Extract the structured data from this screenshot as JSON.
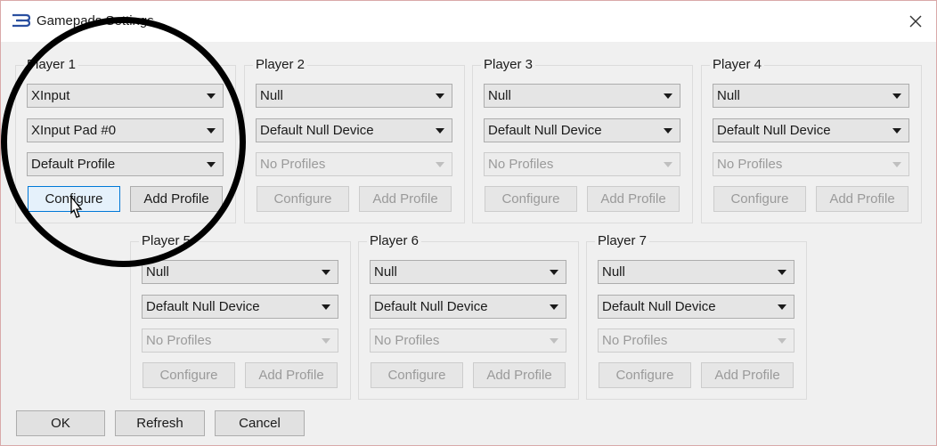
{
  "window": {
    "title": "Gamepads Settings"
  },
  "players": [
    {
      "label": "Player 1",
      "handler": "XInput",
      "device": "XInput Pad #0",
      "profile": "Default Profile",
      "configure": "Configure",
      "add_profile": "Add Profile",
      "enabled": true
    },
    {
      "label": "Player 2",
      "handler": "Null",
      "device": "Default Null Device",
      "profile": "No Profiles",
      "configure": "Configure",
      "add_profile": "Add Profile",
      "enabled": false
    },
    {
      "label": "Player 3",
      "handler": "Null",
      "device": "Default Null Device",
      "profile": "No Profiles",
      "configure": "Configure",
      "add_profile": "Add Profile",
      "enabled": false
    },
    {
      "label": "Player 4",
      "handler": "Null",
      "device": "Default Null Device",
      "profile": "No Profiles",
      "configure": "Configure",
      "add_profile": "Add Profile",
      "enabled": false
    },
    {
      "label": "Player 5",
      "handler": "Null",
      "device": "Default Null Device",
      "profile": "No Profiles",
      "configure": "Configure",
      "add_profile": "Add Profile",
      "enabled": false
    },
    {
      "label": "Player 6",
      "handler": "Null",
      "device": "Default Null Device",
      "profile": "No Profiles",
      "configure": "Configure",
      "add_profile": "Add Profile",
      "enabled": false
    },
    {
      "label": "Player 7",
      "handler": "Null",
      "device": "Default Null Device",
      "profile": "No Profiles",
      "configure": "Configure",
      "add_profile": "Add Profile",
      "enabled": false
    }
  ],
  "footer": {
    "ok": "OK",
    "refresh": "Refresh",
    "cancel": "Cancel"
  },
  "icons": {
    "app": "rpcs3-logo-icon",
    "close": "close-icon",
    "dropdown": "chevron-down-icon",
    "cursor": "mouse-pointer-icon"
  },
  "colors": {
    "accent": "#0078d7",
    "annotation_circle": "#000000",
    "logo": "#2a4fa0"
  }
}
